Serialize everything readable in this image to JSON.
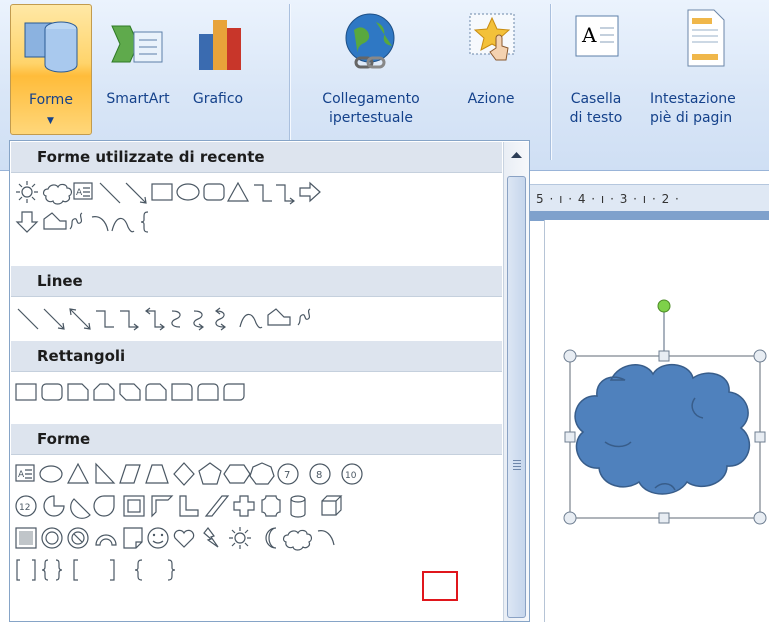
{
  "ribbon": {
    "buttons": [
      {
        "id": "forme",
        "label": "Forme"
      },
      {
        "id": "smartart",
        "label": "SmartArt"
      },
      {
        "id": "grafico",
        "label": "Grafico"
      },
      {
        "id": "collegamento",
        "label_line1": "Collegamento",
        "label_line2": "ipertestuale"
      },
      {
        "id": "azione",
        "label": "Azione"
      },
      {
        "id": "casella",
        "label_line1": "Casella",
        "label_line2": "di testo"
      },
      {
        "id": "intestazione",
        "label_line1": "Intestazione",
        "label_line2": "piè di pagin"
      }
    ],
    "active_button": "forme",
    "accent_color": "#ffc84d"
  },
  "panel": {
    "sections": [
      {
        "title": "Forme utilizzate di recente"
      },
      {
        "title": "Linee"
      },
      {
        "title": "Rettangoli"
      },
      {
        "title": "Forme"
      }
    ],
    "selected_shape": "cloud",
    "highlight_color": "#e0161c"
  },
  "ruler": {
    "text": "5 · ı · 4 · ı · 3 · ı · 2 ·"
  },
  "slide": {
    "shape": "cloud",
    "fill_color": "#4f81bd",
    "outline_color": "#385d8a"
  }
}
